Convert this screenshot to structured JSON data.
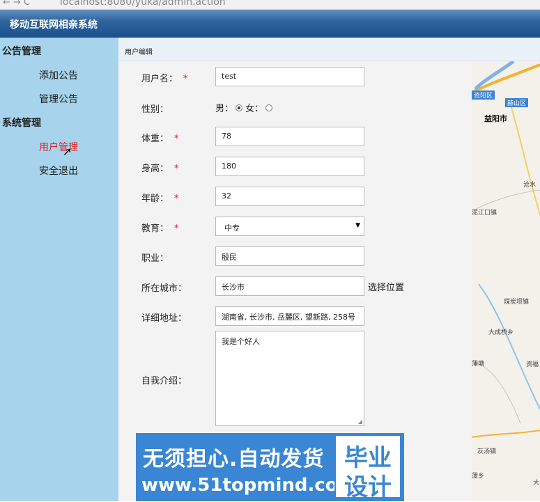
{
  "browser": {
    "nav": "←  →  C",
    "url": "localhost:8080/yuka/admin.action"
  },
  "app": {
    "title": "移动互联网相亲系统"
  },
  "sidebar": {
    "groups": [
      {
        "title": "公告管理",
        "items": [
          "添加公告",
          "管理公告"
        ]
      },
      {
        "title": "系统管理",
        "items": [
          "用户管理",
          "安全退出"
        ]
      }
    ]
  },
  "page": {
    "breadcrumb": "用户编辑"
  },
  "form": {
    "required_mark": "*",
    "username": {
      "label": "用户名：",
      "value": "test"
    },
    "gender": {
      "label": "性别：",
      "male": "男：",
      "female": "女：",
      "selected": "male"
    },
    "weight": {
      "label": "体重：",
      "value": "78"
    },
    "height": {
      "label": "身高：",
      "value": "180"
    },
    "age": {
      "label": "年龄：",
      "value": "32"
    },
    "education": {
      "label": "教育：",
      "value": "中专"
    },
    "occupation": {
      "label": "职业：",
      "value": "殷民"
    },
    "city": {
      "label": "所在城市：",
      "value": "长沙市",
      "pick_label": "选择位置"
    },
    "address": {
      "label": "详细地址：",
      "value": "湖南省, 长沙市, 岳麓区, 望新路, 258号"
    },
    "intro": {
      "label": "自我介绍：",
      "value": "我是个好人"
    }
  },
  "map": {
    "labels": [
      "资阳区",
      "赫山区",
      "益阳市",
      "沧水",
      "泥江口镇",
      "煤炭坝镇",
      "大成桥乡",
      "蒲塘",
      "资福",
      "灰汤镇",
      "菠乡",
      "大"
    ]
  },
  "watermark": {
    "line1": "无须担心.自动发货",
    "line2": "www.51topmind.com",
    "box_top": "毕业",
    "box_bottom": "设计"
  },
  "colors": {
    "header": "#2f659f",
    "sidebar": "#a7d3ec",
    "active": "#e21d1d",
    "watermark": "#3a86d4"
  }
}
